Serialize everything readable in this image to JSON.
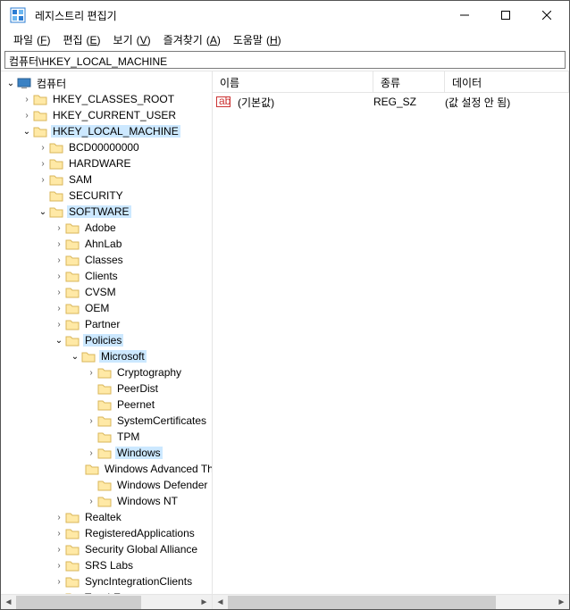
{
  "window": {
    "title": "레지스트리 편집기",
    "address": "컴퓨터\\HKEY_LOCAL_MACHINE"
  },
  "menu": {
    "file": "파일",
    "file_u": "F",
    "edit": "편집",
    "edit_u": "E",
    "view": "보기",
    "view_u": "V",
    "fav": "즐겨찾기",
    "fav_u": "A",
    "help": "도움말",
    "help_u": "H"
  },
  "cols": {
    "name": "이름",
    "type": "종류",
    "data": "데이터"
  },
  "value_row": {
    "name": "(기본값)",
    "type": "REG_SZ",
    "data": "(값 설정 안 됨)"
  },
  "tree": {
    "root": "컴퓨터",
    "hkcr": "HKEY_CLASSES_ROOT",
    "hkcu": "HKEY_CURRENT_USER",
    "hklm": "HKEY_LOCAL_MACHINE",
    "bcd": "BCD00000000",
    "hardware": "HARDWARE",
    "sam": "SAM",
    "security": "SECURITY",
    "software": "SOFTWARE",
    "adobe": "Adobe",
    "ahnlab": "AhnLab",
    "classes": "Classes",
    "clients": "Clients",
    "cvsm": "CVSM",
    "oem": "OEM",
    "partner": "Partner",
    "policies": "Policies",
    "microsoft": "Microsoft",
    "crypto": "Cryptography",
    "peerdist": "PeerDist",
    "peernet": "Peernet",
    "syscert": "SystemCertificates",
    "tpm": "TPM",
    "windows": "Windows",
    "winadv": "Windows Advanced Threat Protection",
    "windef": "Windows Defender",
    "winnt": "Windows NT",
    "realtek": "Realtek",
    "regapps": "RegisteredApplications",
    "sga": "Security Global Alliance",
    "srs": "SRS Labs",
    "sync": "SyncIntegrationClients",
    "touchen": "TouchEn"
  }
}
